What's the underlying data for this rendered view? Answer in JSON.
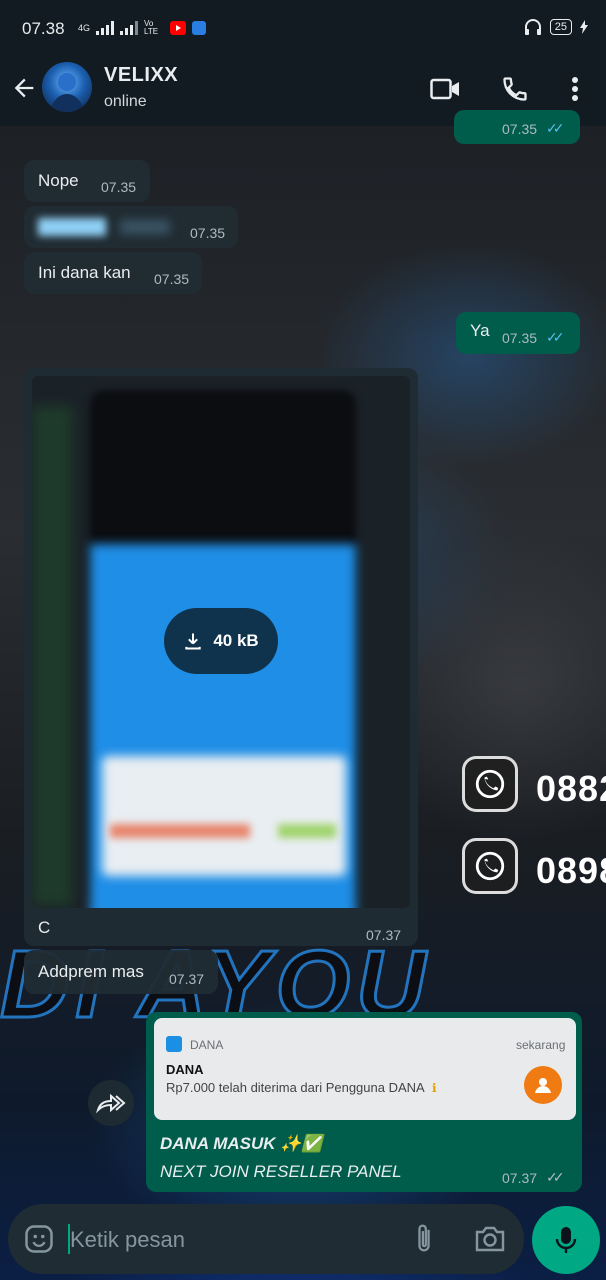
{
  "status_bar": {
    "time": "07.38",
    "network_label": "4G",
    "volte_label": "Vo LTE",
    "battery": "25"
  },
  "header": {
    "contact_name": "VELIXX",
    "contact_status": "online"
  },
  "wallpaper": {
    "big_text": "DI AYOU",
    "phone_1": "0882",
    "phone_2": "0898"
  },
  "messages": [
    {
      "direction": "out",
      "text": "",
      "time": "07.35",
      "read": true
    },
    {
      "direction": "in",
      "text": "Nope",
      "time": "07.35"
    },
    {
      "direction": "in",
      "text": "",
      "time": "07.35",
      "redacted": true
    },
    {
      "direction": "in",
      "text": "Ini dana kan",
      "time": "07.35"
    },
    {
      "direction": "out",
      "text": "Ya",
      "time": "07.35",
      "read": true
    },
    {
      "direction": "in",
      "type": "image",
      "download_size": "40 kB",
      "caption": "C",
      "time": "07.37"
    },
    {
      "direction": "in",
      "text": "Addprem mas",
      "time": "07.37"
    },
    {
      "direction": "out",
      "type": "notification-share",
      "notification": {
        "app_name": "DANA",
        "time": "sekarang",
        "title": "DANA",
        "body": "Rp7.000 telah diterima dari Pengguna DANA"
      },
      "line1": "DANA MASUK ✨✅",
      "line2": "NEXT JOIN RESELLER PANEL",
      "time": "07.37",
      "read": false
    }
  ],
  "input": {
    "placeholder": "Ketik pesan"
  },
  "colors": {
    "header_bg": "#111b21",
    "incoming_bubble": "#202c33",
    "outgoing_bubble": "#005c4b",
    "accent": "#00a884",
    "read_ticks": "#53bdeb"
  }
}
